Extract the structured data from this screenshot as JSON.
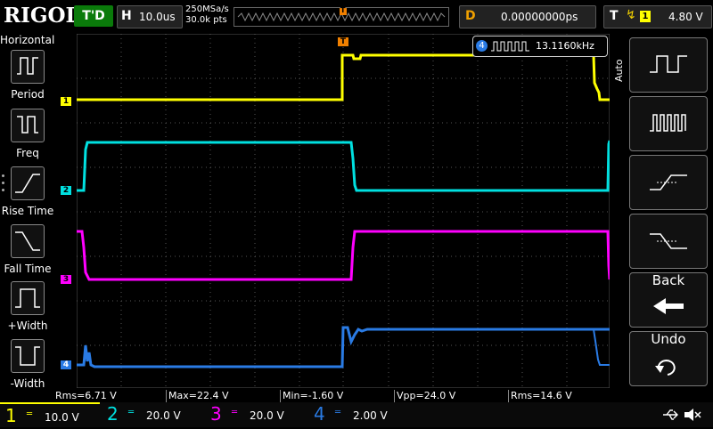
{
  "top": {
    "logo": "RIGOL",
    "run_state": "T'D",
    "horiz_key": "H",
    "timebase": "10.0us",
    "sample_rate": "250MSa/s",
    "mem_depth": "30.0k pts",
    "trigger_marker": "T",
    "delay_key": "D",
    "delay_value": "0.00000000ps",
    "trig_key": "T",
    "trig_source": "1",
    "trig_level": "4.80 V"
  },
  "left": {
    "title": "Horizontal",
    "items": [
      {
        "label": "Period"
      },
      {
        "label": "Freq"
      },
      {
        "label": "Rise Time"
      },
      {
        "label": "Fall Time"
      },
      {
        "label": "+Width"
      },
      {
        "label": "-Width"
      }
    ]
  },
  "freq_readout": {
    "channel": "4",
    "value": "13.1160kHz"
  },
  "right": {
    "mode": "Auto",
    "back_label": "Back",
    "undo_label": "Undo"
  },
  "measurements": [
    {
      "text": "Rms=6.71 V",
      "color": "#ffff00"
    },
    {
      "text": "Max=22.4 V",
      "color": "#00e0e0"
    },
    {
      "text": "Min=-1.60 V",
      "color": "#00e0e0"
    },
    {
      "text": "Vpp=24.0 V",
      "color": "#00e0e0"
    },
    {
      "text": "Rms=14.6 V",
      "color": "#00e0e0"
    }
  ],
  "channels": [
    {
      "num": "1",
      "scale": "10.0 V",
      "color": "#ffff00"
    },
    {
      "num": "2",
      "scale": "20.0 V",
      "color": "#00e0e0"
    },
    {
      "num": "3",
      "scale": "20.0 V",
      "color": "#ff00ff"
    },
    {
      "num": "4",
      "scale": "2.00 V",
      "color": "#2a7be4"
    }
  ],
  "trace_markers": [
    "1",
    "2",
    "3",
    "4"
  ]
}
